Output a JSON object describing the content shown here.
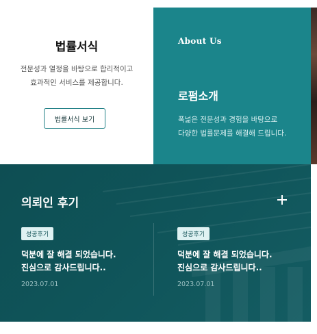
{
  "forms": {
    "title": "법률서식",
    "desc_line1": "전문성과 열정을 바탕으로 합리적이고",
    "desc_line2": "효과적인 서비스를 제공합니다.",
    "button_label": "법률서식 보기"
  },
  "about": {
    "eyebrow": "About Us",
    "title": "로펌소개",
    "desc_line1": "폭넓은 전문성과 경험을 바탕으로",
    "desc_line2": "다양한 법률문제를 해결해 드립니다."
  },
  "reviews": {
    "title": "의뢰인 후기",
    "plus_icon": "plus-icon",
    "items": [
      {
        "badge": "성공후기",
        "line1": "덕분에 잘 해결 되었습니다.",
        "line2": "진심으로 감사드립니다..",
        "date": "2023.07.01"
      },
      {
        "badge": "성공후기",
        "line1": "덕분에 잘 해결 되었습니다.",
        "line2": "진심으로 감사드립니다..",
        "date": "2023.07.01"
      }
    ]
  },
  "colors": {
    "teal": "#1b858b",
    "dark_teal": "#0f5459",
    "button_border": "#1f7f85"
  }
}
